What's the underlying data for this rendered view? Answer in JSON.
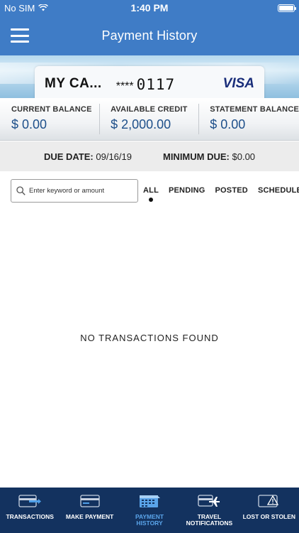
{
  "status_bar": {
    "carrier": "No SIM",
    "time": "1:40 PM"
  },
  "header": {
    "title": "Payment History"
  },
  "card": {
    "name": "MY CA...",
    "mask": "****",
    "last4": "0117",
    "network": "VISA"
  },
  "balances": [
    {
      "label": "CURRENT BALANCE",
      "amount": "$ 0.00"
    },
    {
      "label": "AVAILABLE CREDIT",
      "amount": "$ 2,000.00"
    },
    {
      "label": "STATEMENT BALANCE",
      "amount": "$ 0.00"
    }
  ],
  "due": {
    "due_date_label": "DUE DATE:",
    "due_date": "09/16/19",
    "minimum_due_label": "MINIMUM DUE:",
    "minimum_due": "$0.00"
  },
  "search": {
    "placeholder": "Enter keyword or amount"
  },
  "filters": [
    {
      "label": "ALL",
      "active": true
    },
    {
      "label": "PENDING",
      "active": false
    },
    {
      "label": "POSTED",
      "active": false
    },
    {
      "label": "SCHEDULED",
      "active": false
    }
  ],
  "empty_message": "NO TRANSACTIONS FOUND",
  "tabs": [
    {
      "label": "TRANSACTIONS",
      "icon": "card-transfer-icon",
      "active": false
    },
    {
      "label": "MAKE PAYMENT",
      "icon": "card-payment-icon",
      "active": false
    },
    {
      "label": "PAYMENT\nHISTORY",
      "icon": "calendar-icon",
      "active": true
    },
    {
      "label": "TRAVEL\nNOTIFICATIONS",
      "icon": "plane-icon",
      "active": false
    },
    {
      "label": "LOST OR STOLEN",
      "icon": "warning-icon",
      "active": false
    }
  ],
  "colors": {
    "header_blue": "#3f7cc6",
    "tabbar_navy": "#13325f",
    "active_tab": "#5aa4ea",
    "amount_blue": "#1d4f8a"
  }
}
